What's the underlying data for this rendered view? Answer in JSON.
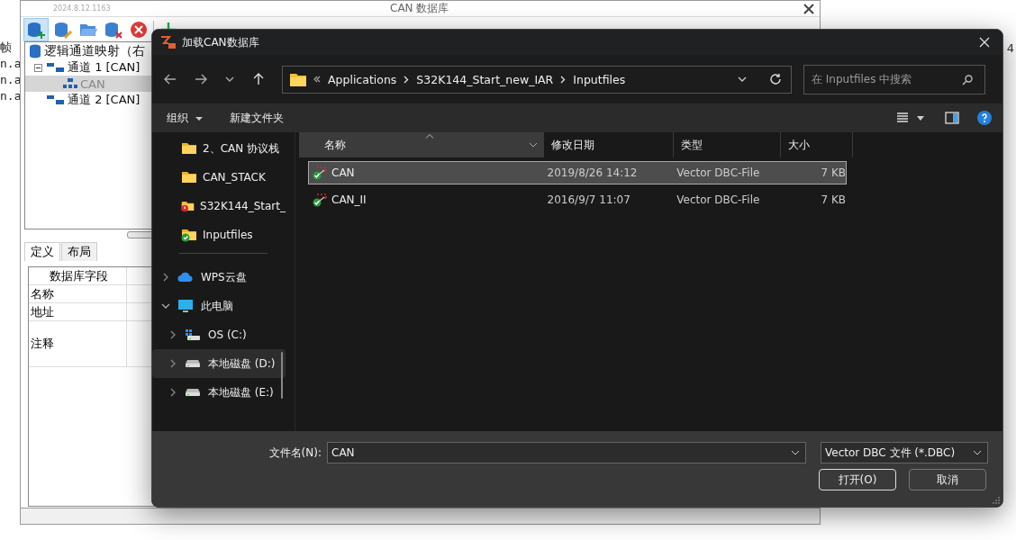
{
  "back_window": {
    "left_edge_texts": [
      "帧",
      "n.a",
      "n.a",
      "n.a"
    ],
    "right_edge_text": "4"
  },
  "app_window": {
    "version": "2024.8.12.1163",
    "title": "CAN 数据库",
    "tree": {
      "header": "逻辑通道映射（右",
      "items": [
        {
          "label": "通道 1 [CAN]",
          "expanded": true,
          "selected": false,
          "children": [
            {
              "label": "CAN",
              "selected": true
            }
          ]
        },
        {
          "label": "通道 2 [CAN]",
          "selected": false
        }
      ]
    },
    "tabs": [
      {
        "label": "定义",
        "selected": true
      },
      {
        "label": "布局",
        "selected": false
      }
    ],
    "fields_table": {
      "header": "数据库字段",
      "rows": [
        "名称",
        "地址",
        "注释"
      ]
    }
  },
  "dialog": {
    "title": "加载CAN数据库",
    "path": [
      "Applications",
      "S32K144_Start_new_IAR",
      "Inputfiles"
    ],
    "search_placeholder": "在 Inputfiles 中搜索",
    "toolbar": [
      "组织",
      "新建文件夹"
    ],
    "nav_folders": [
      {
        "label": "2、CAN 协议栈",
        "kind": "folder"
      },
      {
        "label": "CAN_STACK",
        "kind": "folder"
      },
      {
        "label": "S32K144_Start_",
        "kind": "folder-error"
      },
      {
        "label": "Inputfiles",
        "kind": "folder-ok"
      }
    ],
    "nav_locations": [
      {
        "label": "WPS云盘",
        "kind": "cloud",
        "expanded": false,
        "selected": false
      },
      {
        "label": "此电脑",
        "kind": "pc",
        "expanded": true,
        "selected": false,
        "children": [
          {
            "label": "OS (C:)",
            "kind": "os-drive",
            "expanded": false,
            "selected": false
          },
          {
            "label": "本地磁盘 (D:)",
            "kind": "drive",
            "expanded": false,
            "selected": true
          },
          {
            "label": "本地磁盘 (E:)",
            "kind": "drive",
            "expanded": false,
            "selected": false
          }
        ]
      }
    ],
    "columns": [
      {
        "label": "名称",
        "sorted": true
      },
      {
        "label": "修改日期",
        "sorted": false
      },
      {
        "label": "类型",
        "sorted": false
      },
      {
        "label": "大小",
        "sorted": false
      }
    ],
    "files": [
      {
        "name": "CAN",
        "date": "2019/8/26 14:12",
        "type": "Vector DBC-File",
        "size": "7 KB",
        "selected": true
      },
      {
        "name": "CAN_II",
        "date": "2016/9/7 11:07",
        "type": "Vector DBC-File",
        "size": "7 KB",
        "selected": false
      }
    ],
    "file_name_label": "文件名(N):",
    "file_name": "CAN",
    "file_type": "Vector DBC 文件 (*.DBC)",
    "buttons": [
      {
        "label": "打开(O)",
        "default": true
      },
      {
        "label": "取消",
        "default": false
      }
    ]
  }
}
